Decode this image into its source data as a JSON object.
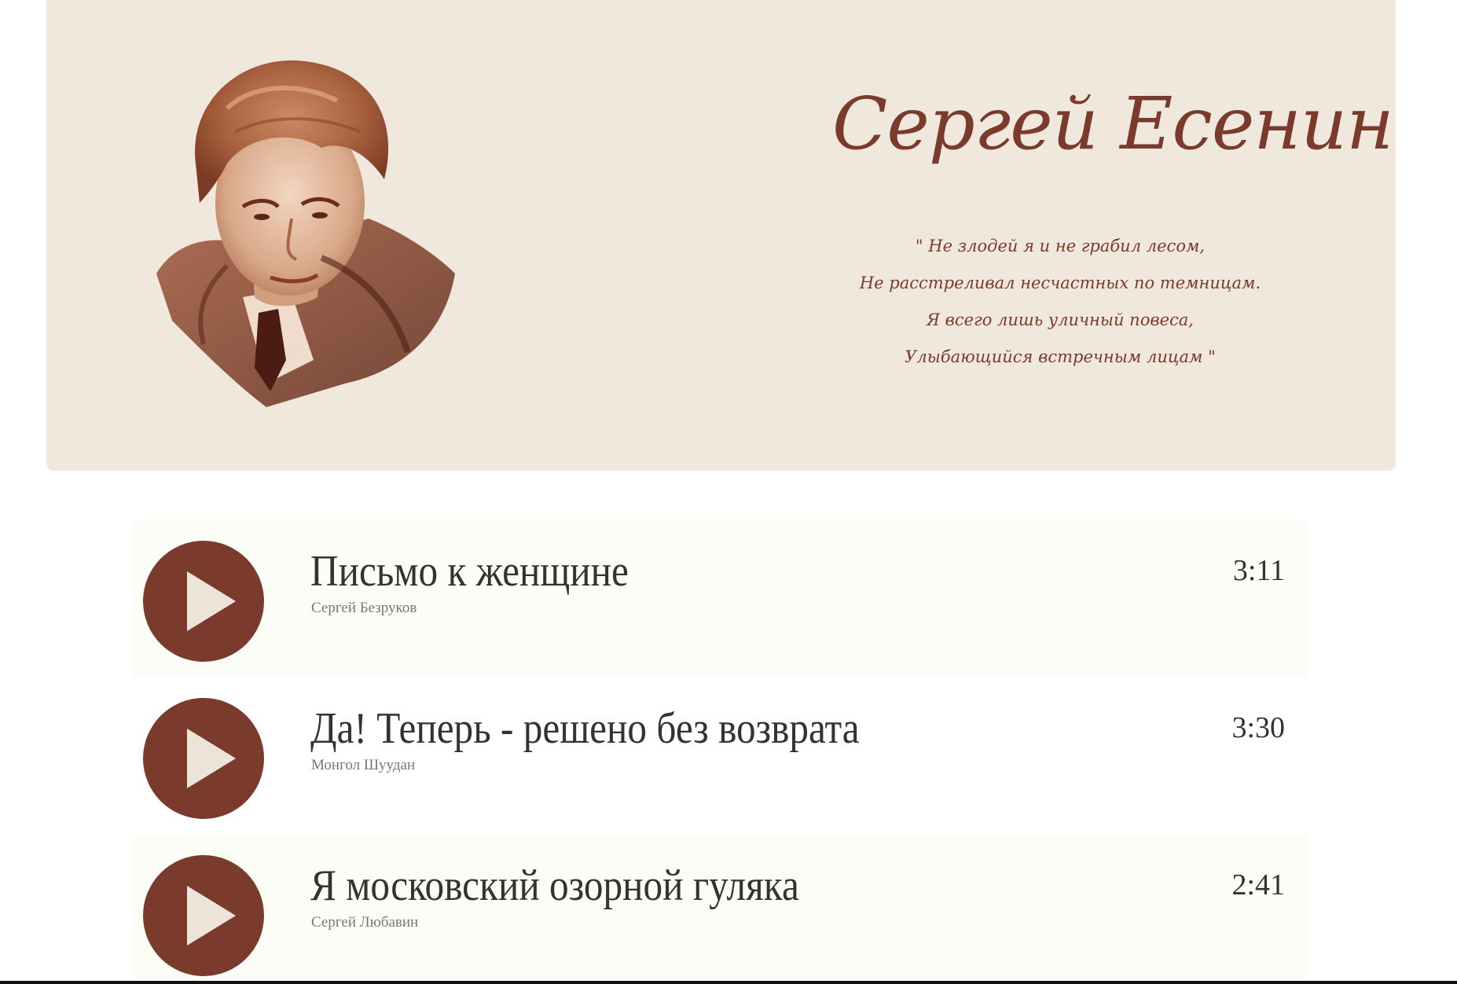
{
  "header": {
    "name": "Сергей Есенин",
    "quote": [
      "\" Не злодей я и не грабил лесом,",
      "Не расстреливал несчастных по темницам.",
      "Я всего лишь уличный повеса,",
      "Улыбающийся встречным лицам \""
    ]
  },
  "tracks": [
    {
      "title": "Письмо к женщине",
      "artist": "Сергей Безруков",
      "duration": "3:11",
      "icon": "play-icon"
    },
    {
      "title": "Да! Теперь - решено без возврата",
      "artist": "Монгол Шуудан",
      "duration": "3:30",
      "icon": "play-icon"
    },
    {
      "title": "Я московский озорной гуляка",
      "artist": "Сергей Любавин",
      "duration": "2:41",
      "icon": "play-icon"
    }
  ],
  "colors": {
    "hero_bg": "#f0e7dd",
    "accent": "#7a3a2c",
    "play_triangle": "#ece4d8",
    "row_bg": "#fdfdf7"
  }
}
